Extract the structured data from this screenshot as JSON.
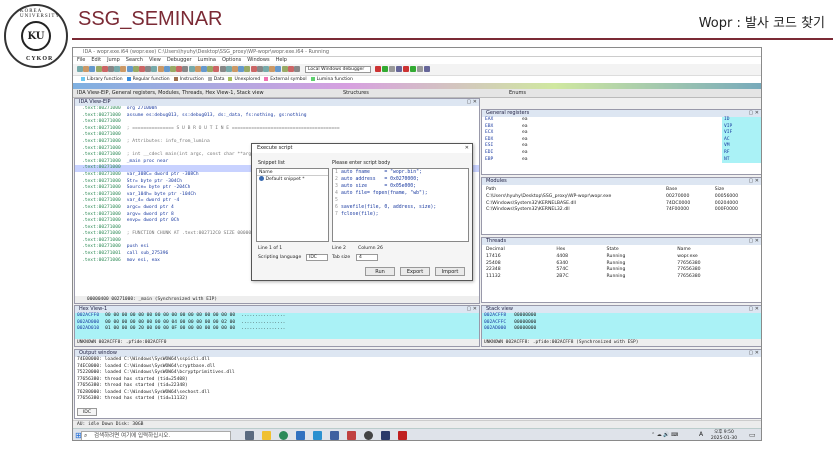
{
  "header": {
    "logo_ring_text": "KOREA UNIVERSITY",
    "logo_bottom_text": "CYKOR",
    "logo_center": "KU",
    "title": "SSG_SEMINAR",
    "subtitle": "Wopr : 발사 코드 찾기"
  },
  "window": {
    "title": "IDA - wopr.exe.i64 (wopr.exe) C:\\Users\\hyuhy\\Desktop\\SSG_proxy\\WP-wopr\\wopr.exe.i64 - Running",
    "menu": [
      "File",
      "Edit",
      "Jump",
      "Search",
      "View",
      "Debugger",
      "Lumina",
      "Options",
      "Windows",
      "Help"
    ],
    "debugger_select": "Local Windows debugger",
    "legend": [
      {
        "label": "Library function",
        "color": "#6ec8f0"
      },
      {
        "label": "Regular function",
        "color": "#3a8ee0"
      },
      {
        "label": "Instruction",
        "color": "#a07050"
      },
      {
        "label": "Data",
        "color": "#b0b0b0"
      },
      {
        "label": "Unexplored",
        "color": "#a8c060"
      },
      {
        "label": "External symbol",
        "color": "#f070b0"
      },
      {
        "label": "Lumina function",
        "color": "#60d070"
      }
    ],
    "tabs": {
      "main": "IDA View-EIP, General registers, Modules, Threads, Hex View-1, Stack view",
      "structures": "Structures",
      "enums": "Enums"
    }
  },
  "ida_view": {
    "title": "IDA View-EIP",
    "lines": [
      {
        "addr": ".text:00271000",
        "code": "org 271000h",
        "style": "kw"
      },
      {
        "addr": ".text:00271000",
        "code": "assume es:debug013, ss:debug013, ds:_data, fs:nothing, gs:nothing",
        "style": "kw"
      },
      {
        "addr": ".text:00271000",
        "code": "",
        "style": ""
      },
      {
        "addr": ".text:00271000",
        "code": "; =============== S U B R O U T I N E =======================================",
        "style": "cm"
      },
      {
        "addr": ".text:00271000",
        "code": "",
        "style": ""
      },
      {
        "addr": ".text:00271000",
        "code": "; Attributes: info_from_lumina",
        "style": "cm"
      },
      {
        "addr": ".text:00271000",
        "code": "",
        "style": ""
      },
      {
        "addr": ".text:00271000",
        "code": "; int __cdecl main(int argc, const char **argv, const char **envp)",
        "style": "cm"
      },
      {
        "addr": ".text:00271000",
        "code": "_main proc near",
        "style": "kw"
      },
      {
        "addr": ".text:00271000",
        "code": "",
        "style": "sel"
      },
      {
        "addr": ".text:00271000",
        "code": "var_308C= dword ptr -308Ch",
        "style": "kw"
      },
      {
        "addr": ".text:00271000",
        "code": "Str= byte ptr -304Ch",
        "style": "kw"
      },
      {
        "addr": ".text:00271000",
        "code": "Source= byte ptr -204Ch",
        "style": "kw"
      },
      {
        "addr": ".text:00271000",
        "code": "var_104h= byte ptr -104Ch",
        "style": "kw"
      },
      {
        "addr": ".text:00271000",
        "code": "var_4= dword ptr -4",
        "style": "kw"
      },
      {
        "addr": ".text:00271000",
        "code": "argc= dword ptr  4",
        "style": "kw"
      },
      {
        "addr": ".text:00271000",
        "code": "argv= dword ptr  8",
        "style": "kw"
      },
      {
        "addr": ".text:00271000",
        "code": "envp= dword ptr  0Ch",
        "style": "kw"
      },
      {
        "addr": ".text:00271000",
        "code": "",
        "style": ""
      },
      {
        "addr": ".text:00271000",
        "code": "; FUNCTION CHUNK AT .text:002712C0 SIZE 00000098 BYTES",
        "style": "cm"
      },
      {
        "addr": ".text:00271000",
        "code": "",
        "style": ""
      },
      {
        "addr": ".text:00271000",
        "code": "push    esi",
        "style": "kw"
      },
      {
        "addr": ".text:00271001",
        "code": "call    sub_275396",
        "style": "kw"
      },
      {
        "addr": ".text:00271006",
        "code": "mov     esi, eax",
        "style": "kw"
      }
    ],
    "footer": "00000400 00271000: _main (Synchronized with EIP)"
  },
  "registers": {
    "title": "General registers",
    "rows": [
      {
        "name": "EAX",
        "val": "ea",
        "flag": "ID"
      },
      {
        "name": "EBX",
        "val": "ea",
        "flag": "VIP"
      },
      {
        "name": "ECX",
        "val": "ea",
        "flag": "VIF"
      },
      {
        "name": "EDX",
        "val": "ea",
        "flag": "AC"
      },
      {
        "name": "ESI",
        "val": "ea",
        "flag": "VM"
      },
      {
        "name": "EDI",
        "val": "ea",
        "flag": "RF"
      },
      {
        "name": "EBP",
        "val": "ea",
        "flag": "NT"
      }
    ]
  },
  "modules": {
    "title": "Modules",
    "columns": [
      "Path",
      "Base",
      "Size"
    ],
    "rows": [
      {
        "path": "C:\\Users\\hyuhy\\Desktop\\SSG_proxy\\WP-wopr\\wopr.exe",
        "base": "00270000",
        "size": "00056000"
      },
      {
        "path": "C:\\Windows\\System32\\KERNELBASE.dll",
        "base": "74DC0000",
        "size": "00204000"
      },
      {
        "path": "C:\\Windows\\System32\\KERNEL32.dll",
        "base": "74F00000",
        "size": "000F0000"
      }
    ]
  },
  "threads": {
    "title": "Threads",
    "columns": [
      "Decimal",
      "Hex",
      "State",
      "Name"
    ],
    "rows": [
      {
        "dec": "17416",
        "hex": "4408",
        "state": "Running",
        "name": "wopr.exe"
      },
      {
        "dec": "25408",
        "hex": "6340",
        "state": "Running",
        "name": "77656380"
      },
      {
        "dec": "22348",
        "hex": "574C",
        "state": "Running",
        "name": "77656380"
      },
      {
        "dec": "11132",
        "hex": "2B7C",
        "state": "Running",
        "name": "77656380"
      }
    ]
  },
  "hex_view": {
    "title": "Hex View-1",
    "rows": [
      {
        "addr": "002ACFF0",
        "bytes": "00 00 00 00 00 00 00 00  00 00 00 00 00 00 00 00",
        "ascii": "................"
      },
      {
        "addr": "002AD000",
        "bytes": "00 00 00 00 00 00 00 00  04 00 00 00 00 00 02 00",
        "ascii": "................"
      },
      {
        "addr": "002AD010",
        "bytes": "01 00 00 00 20 00 00 00  0F 00 00 00 00 00 00 00",
        "ascii": "................"
      }
    ],
    "footer": "UNKNOWN 002ACFF0: .pfide:002ACFF0"
  },
  "stack_view": {
    "title": "Stack view",
    "rows": [
      {
        "addr": "002ACFF8",
        "val": "00000000"
      },
      {
        "addr": "002ACFFC",
        "val": "00000000"
      },
      {
        "addr": "002AD000",
        "val": "00000000"
      }
    ],
    "footer": "UNKNOWN 002ACFF8: .pfide:002ACFF8 (Synchronized with ESP)"
  },
  "output": {
    "title": "Output window",
    "lines": [
      "74E00000: loaded C:\\Windows\\SysWOW64\\sspicli.dll",
      "74EC0000: loaded C:\\Windows\\SysWOW64\\cryptbase.dll",
      "75220000: loaded C:\\Windows\\SysWOW64\\bcryptprimitives.dll",
      "77656380: thread has started (tid=25408)",
      "77656380: thread has started (tid=22348)",
      "76280000: loaded C:\\Windows\\SysWOW64\\sechost.dll",
      "77656380: thread has started (tid=11132)"
    ],
    "prompt": "IDC"
  },
  "status_bar": "AU:  idle  Down   Disk: 30GB",
  "dialog": {
    "title": "Execute script",
    "snippet_label": "Snippet list",
    "snippet_col": "Name",
    "snippet_item": "Default snippet *",
    "script_label": "Please enter script body",
    "code": [
      "auto fname     = \"wopr.bin\";",
      "auto address   = 0x0270000;",
      "auto size      = 0x05e000;",
      "auto file= fopen(fname, \"wb\");",
      "",
      "savefile(file, 0, address, size);",
      "fclose(file);"
    ],
    "line_info": "Line 1 of 1",
    "line_col": "Line 2",
    "column": "Column 26",
    "lang_label": "Scripting language",
    "lang_value": "IDC",
    "tab_label": "Tab size",
    "tab_value": "4",
    "buttons": [
      "Run",
      "Export",
      "Import"
    ]
  },
  "taskbar": {
    "search_placeholder": "검색하려면 여기에 입력하십시오.",
    "clock_time": "오후 9:50",
    "clock_date": "2025-01-30",
    "lang": "A"
  }
}
